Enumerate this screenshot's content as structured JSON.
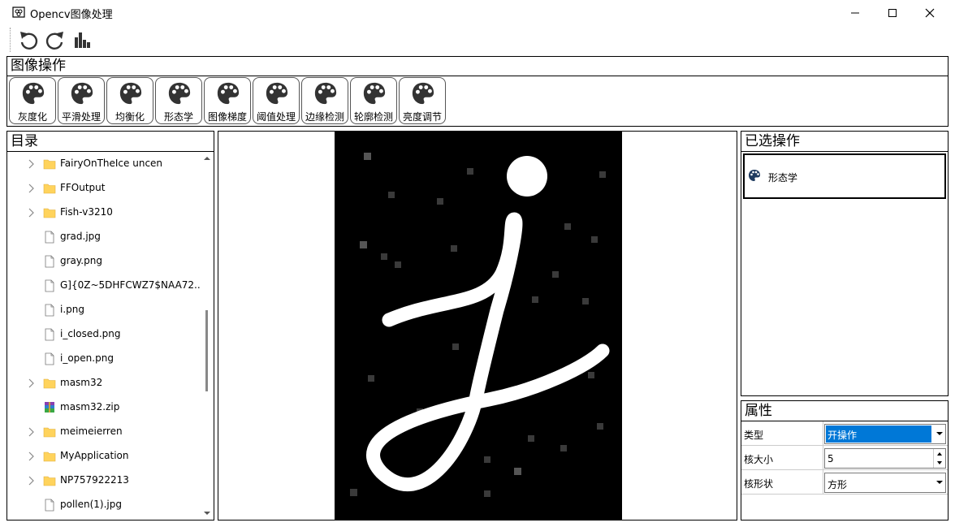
{
  "window": {
    "title": "Opencv图像处理",
    "minimize": "–",
    "maximize": "☐",
    "close": "✕"
  },
  "toolbar": {
    "icons": [
      "undo-icon",
      "redo-icon",
      "histogram-icon"
    ]
  },
  "ops": {
    "title": "图像操作",
    "buttons": [
      "灰度化",
      "平滑处理",
      "均衡化",
      "形态学",
      "图像梯度",
      "阈值处理",
      "边缘检测",
      "轮廓检测",
      "亮度调节"
    ]
  },
  "dir": {
    "title": "目录",
    "items": [
      {
        "label": "FairyOnTheIce uncen",
        "type": "folder",
        "expandable": true
      },
      {
        "label": "FFOutput",
        "type": "folder",
        "expandable": true
      },
      {
        "label": "Fish-v3210",
        "type": "folder",
        "expandable": true
      },
      {
        "label": "grad.jpg",
        "type": "file",
        "expandable": false
      },
      {
        "label": "gray.png",
        "type": "file",
        "expandable": false
      },
      {
        "label": "G]{0Z~5DHFCWZ7$NAA72...",
        "type": "file",
        "expandable": false
      },
      {
        "label": "i.png",
        "type": "file",
        "expandable": false
      },
      {
        "label": "i_closed.png",
        "type": "file",
        "expandable": false
      },
      {
        "label": "i_open.png",
        "type": "file",
        "expandable": false
      },
      {
        "label": "masm32",
        "type": "folder",
        "expandable": true
      },
      {
        "label": "masm32.zip",
        "type": "archive",
        "expandable": false
      },
      {
        "label": "meimeierren",
        "type": "folder",
        "expandable": true
      },
      {
        "label": "MyApplication",
        "type": "folder",
        "expandable": true
      },
      {
        "label": "NP757922213",
        "type": "folder",
        "expandable": true
      },
      {
        "label": "pollen(1).jpg",
        "type": "file",
        "expandable": false
      }
    ]
  },
  "selected": {
    "title": "已选操作",
    "item": "形态学"
  },
  "props": {
    "title": "属性",
    "type_label": "类型",
    "type_value": "开操作",
    "ksize_label": "核大小",
    "ksize_value": "5",
    "kshape_label": "核形状",
    "kshape_value": "方形"
  },
  "colors": {
    "selection": "#0078d7",
    "folder": "#ffd35c",
    "border": "#000000"
  }
}
